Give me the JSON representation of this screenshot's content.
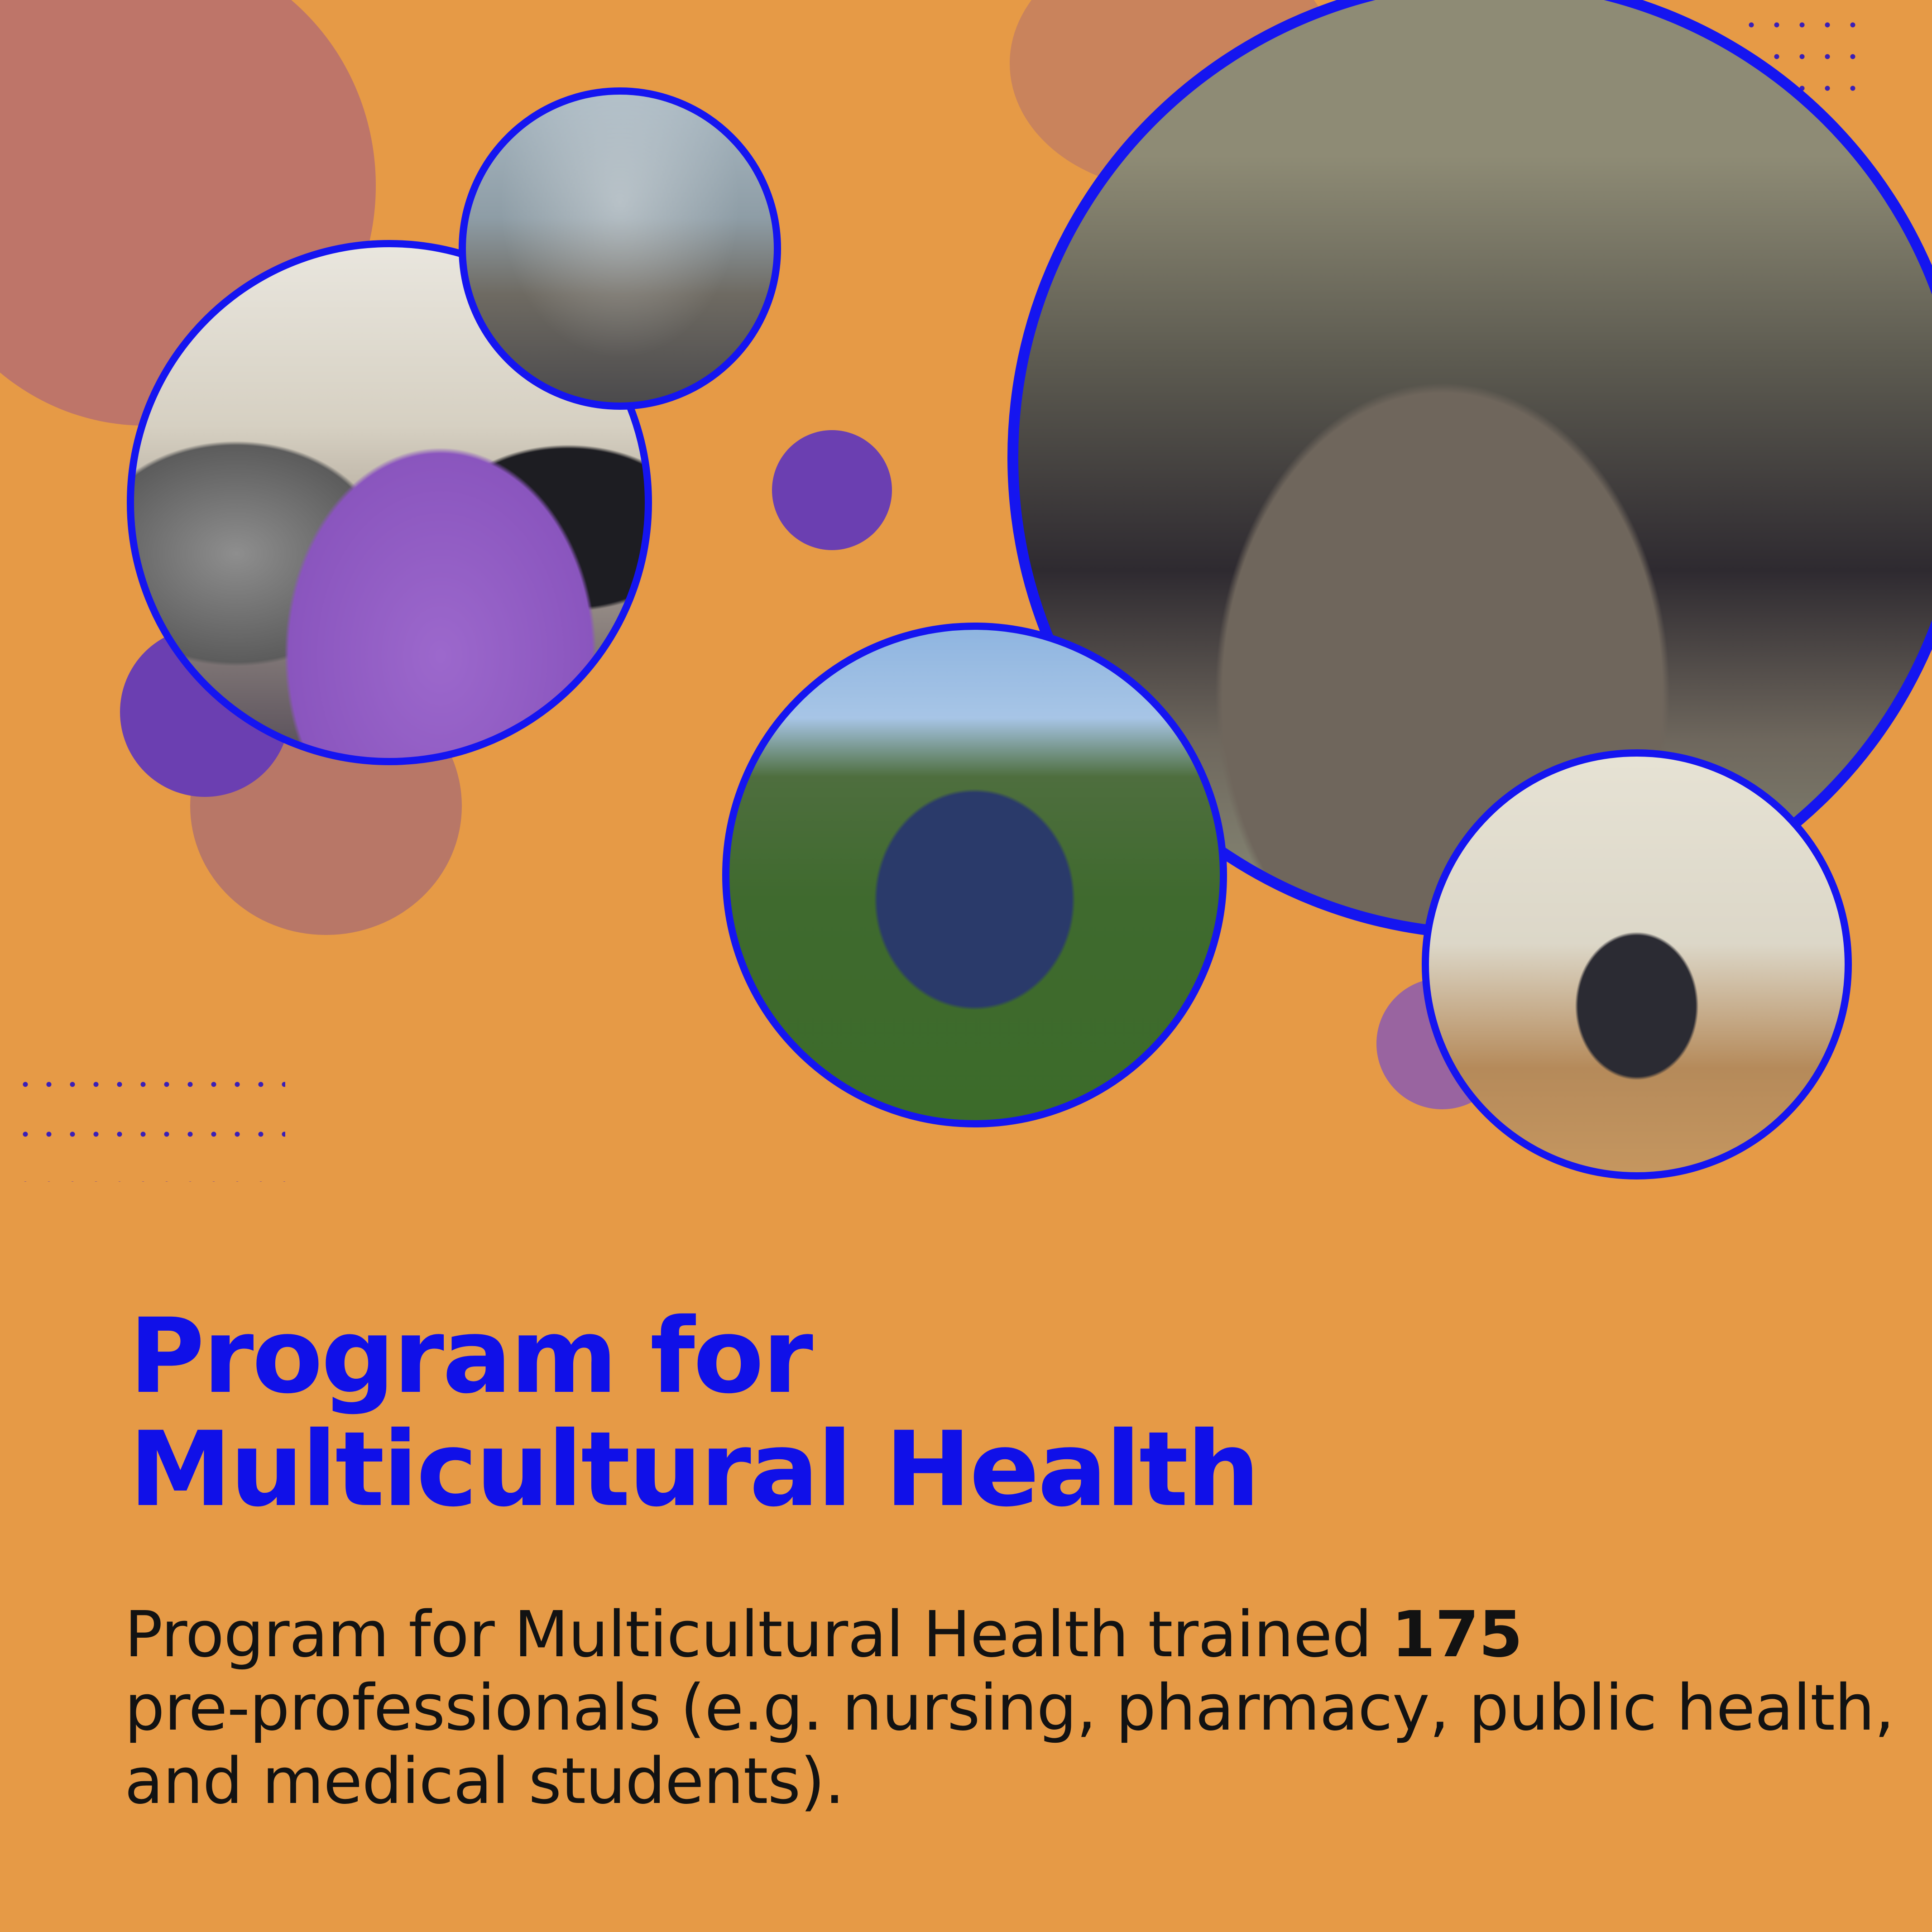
{
  "colors": {
    "background": "#E69A46",
    "accent_blue": "#1515F0",
    "purple_circle": "#6B3FB1",
    "rose_circle": "#BE7569",
    "text_dark": "#121212"
  },
  "photos": [
    {
      "name": "students-watching-presentation-photo"
    },
    {
      "name": "students-at-purple-table-photo"
    },
    {
      "name": "group-of-masked-participants-photo"
    },
    {
      "name": "women-in-navy-and-yellow-outdoors-photo"
    },
    {
      "name": "women-with-donated-bags-photo"
    }
  ],
  "heading": {
    "line1": "Program for",
    "line2": "Multicultural Health"
  },
  "description": {
    "line1_text": "Program for Multicultural Health trained ",
    "count": "175",
    "line2": "pre-professionals (e.g. nursing, pharmacy, public health,",
    "line3": "and medical students)."
  }
}
